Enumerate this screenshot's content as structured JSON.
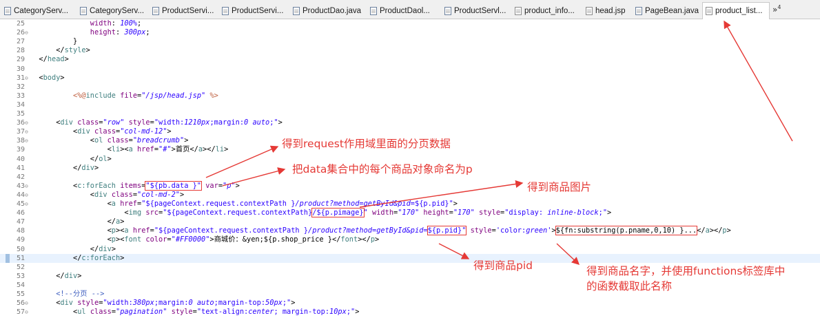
{
  "tabs": [
    {
      "label": "CategoryServ...",
      "icon": "java-file-icon"
    },
    {
      "label": "CategoryServ...",
      "icon": "java-file-icon"
    },
    {
      "label": "ProductServi...",
      "icon": "java-file-icon"
    },
    {
      "label": "ProductServi...",
      "icon": "java-file-icon"
    },
    {
      "label": "ProductDao.java",
      "icon": "java-file-icon"
    },
    {
      "label": "ProductDaol...",
      "icon": "java-file-icon"
    },
    {
      "label": "ProductServl...",
      "icon": "java-file-icon"
    },
    {
      "label": "product_info...",
      "icon": "jsp-file-icon"
    },
    {
      "label": "head.jsp",
      "icon": "jsp-file-icon"
    },
    {
      "label": "PageBean.java",
      "icon": "java-file-icon"
    },
    {
      "label": "product_list...",
      "icon": "jsp-file-icon",
      "active": true
    }
  ],
  "tab_close_glyph": "✕",
  "tab_overflow": {
    "glyph": "»",
    "count": "4"
  },
  "editor": {
    "current_line": 51,
    "lines": [
      {
        "n": 25,
        "fold": "",
        "html": "              <span class='a'>width</span>: <span class='vi'>100%</span>;"
      },
      {
        "n": 26,
        "fold": "⊖",
        "html": "              <span class='a'>height</span>: <span class='vi'>300px</span>;"
      },
      {
        "n": 27,
        "fold": "",
        "html": "          }"
      },
      {
        "n": 28,
        "fold": "",
        "html": "      &lt;/<span class='t'>style</span>&gt;"
      },
      {
        "n": 29,
        "fold": "",
        "html": "  &lt;/<span class='t'>head</span>&gt;"
      },
      {
        "n": 30,
        "fold": "",
        "html": ""
      },
      {
        "n": 31,
        "fold": "⊖",
        "html": "  &lt;<span class='t'>body</span>&gt;"
      },
      {
        "n": 32,
        "fold": "",
        "html": ""
      },
      {
        "n": 33,
        "fold": "",
        "html": "          <span class='jsp'>&lt;%@</span><span class='t'>include</span> <span class='a'>file</span>=<span class='vi'>\"/jsp/head.jsp\"</span> <span class='jsp'>%&gt;</span>"
      },
      {
        "n": 34,
        "fold": "",
        "html": ""
      },
      {
        "n": 35,
        "fold": "",
        "html": ""
      },
      {
        "n": 36,
        "fold": "⊖",
        "html": "      &lt;<span class='t'>div</span> <span class='a'>class</span>=<span class='vi'>\"row\"</span> <span class='a'>style</span>=<span class='v'>\"width:<i>1210px</i>;margin:<i>0 auto</i>;\"</span>&gt;"
      },
      {
        "n": 37,
        "fold": "⊖",
        "html": "          &lt;<span class='t'>div</span> <span class='a'>class</span>=<span class='vi'>\"col-md-12\"</span>&gt;"
      },
      {
        "n": 38,
        "fold": "⊖",
        "html": "              &lt;<span class='t'>ol</span> <span class='a'>class</span>=<span class='vi'>\"breadcrumb\"</span>&gt;"
      },
      {
        "n": 39,
        "fold": "",
        "html": "                  &lt;<span class='t'>li</span>&gt;&lt;<span class='t'>a</span> <span class='a'>href</span>=<span class='vi'>\"#\"</span>&gt;首页&lt;/<span class='t'>a</span>&gt;&lt;/<span class='t'>li</span>&gt;"
      },
      {
        "n": 40,
        "fold": "",
        "html": "              &lt;/<span class='t'>ol</span>&gt;"
      },
      {
        "n": 41,
        "fold": "",
        "html": "          &lt;/<span class='t'>div</span>&gt;"
      },
      {
        "n": 42,
        "fold": "",
        "html": ""
      },
      {
        "n": 43,
        "fold": "⊖",
        "html": "          &lt;<span class='t'>c:forEach</span> <span class='a'>items</span>=<span class='hlbox'><span class='v'>\"${pb.data }\"</span></span> <span class='a'>var</span>=<span class='vi'>\"p\"</span>&gt;"
      },
      {
        "n": 44,
        "fold": "⊖",
        "html": "              &lt;<span class='t'>div</span> <span class='a'>class</span>=<span class='vi'>\"col-md-2\"</span>&gt;"
      },
      {
        "n": 45,
        "fold": "⊖",
        "html": "                  &lt;<span class='t'>a</span> <span class='a'>href</span>=<span class='v'>\"${pageContext.request.contextPath }<i>/product?method=getById&amp;pid=</i>${p.pid}\"</span>&gt;"
      },
      {
        "n": 46,
        "fold": "",
        "html": "                      &lt;<span class='t'>img</span> <span class='a'>src</span>=<span class='v'>\"${pageContext.request.contextPath}<span class='hlbox'>/${p.pimage}</span>\"</span> <span class='a'>width</span>=<span class='vi'>\"170\"</span> <span class='a'>height</span>=<span class='vi'>\"170\"</span> <span class='a'>style</span>=<span class='v'>\"display: <i>inline-block</i>;\"</span>&gt;"
      },
      {
        "n": 47,
        "fold": "",
        "html": "                  &lt;/<span class='t'>a</span>&gt;"
      },
      {
        "n": 48,
        "fold": "",
        "html": "                  &lt;<span class='t'>p</span>&gt;&lt;<span class='t'>a</span> <span class='a'>href</span>=<span class='v'>\"${pageContext.request.contextPath }<i>/product?method=getById&amp;pid=</i><span class='hlbox'>${p.pid}\"</span></span> <span class='a'>style</span>=<span class='v'>'color:<i>green</i>'</span>&gt;<span class='hlbox'>${fn:substring(p.pname,0,10) }...</span>&lt;/<span class='t'>a</span>&gt;&lt;/<span class='t'>p</span>&gt;"
      },
      {
        "n": 49,
        "fold": "",
        "html": "                  &lt;<span class='t'>p</span>&gt;&lt;<span class='t'>font</span> <span class='a'>color</span>=<span class='vi'>\"#FF0000\"</span>&gt;商城价：&amp;yen;${p.shop_price }&lt;/<span class='t'>font</span>&gt;&lt;/<span class='t'>p</span>&gt;"
      },
      {
        "n": 50,
        "fold": "",
        "html": "              &lt;/<span class='t'>div</span>&gt;"
      },
      {
        "n": 51,
        "fold": "",
        "html": "          &lt;/<span class='t'>c:forEach</span>&gt;"
      },
      {
        "n": 52,
        "fold": "",
        "html": ""
      },
      {
        "n": 53,
        "fold": "",
        "html": "      &lt;/<span class='t'>div</span>&gt;"
      },
      {
        "n": 54,
        "fold": "",
        "html": ""
      },
      {
        "n": 55,
        "fold": "",
        "html": "      <span class='cm'>&lt;!--分页 --&gt;</span>"
      },
      {
        "n": 56,
        "fold": "⊖",
        "html": "      &lt;<span class='t'>div</span> <span class='a'>style</span>=<span class='v'>\"width:<i>380px</i>;margin:<i>0 auto</i>;margin-top:<i>50px</i>;\"</span>&gt;"
      },
      {
        "n": 57,
        "fold": "⊖",
        "html": "          &lt;<span class='t'>ul</span> <span class='a'>class</span>=<span class='vi'>\"pagination\"</span> <span class='a'>style</span>=<span class='v'>\"text-align:<i>center</i>; margin-top:<i>10px</i>;\"</span>&gt;"
      }
    ]
  },
  "annotations": [
    {
      "id": "annot-request-scope",
      "text": "得到request作用域里面的分页数据"
    },
    {
      "id": "annot-var-p",
      "text": "把data集合中的每个商品对象命名为p"
    },
    {
      "id": "annot-image",
      "text": "得到商品图片"
    },
    {
      "id": "annot-pid",
      "text": "得到商品pid"
    },
    {
      "id": "annot-name-1",
      "text": "得到商品名字，并使用functions标签库中"
    },
    {
      "id": "annot-name-2",
      "text": "的函数截取此名称"
    }
  ],
  "colors": {
    "annotation": "#e53935",
    "tag": "#3f7f7f",
    "attribute": "#7f007f",
    "value": "#2a00ff",
    "comment": "#3f5fbf",
    "current_line_bg": "#e8f2fe"
  }
}
